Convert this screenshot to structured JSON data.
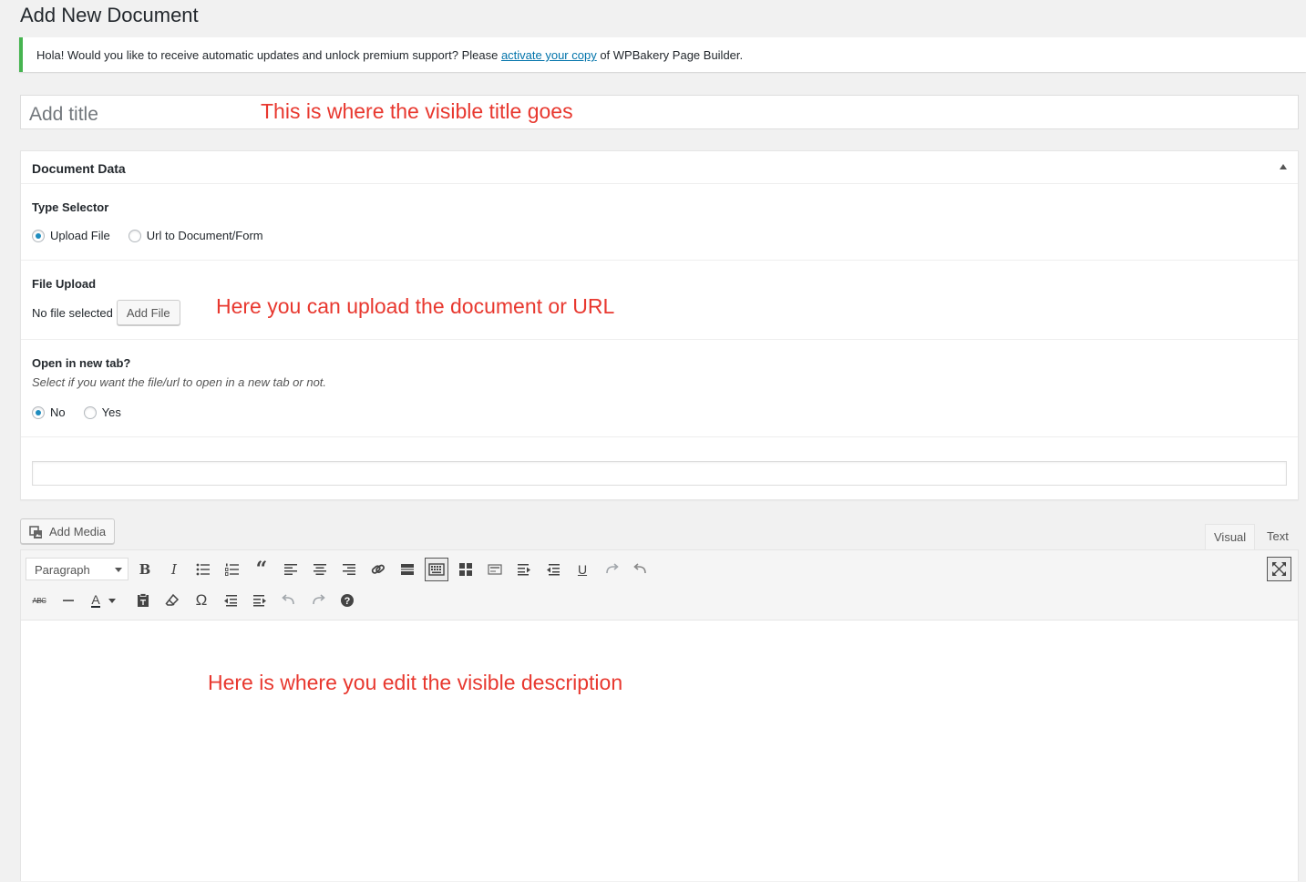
{
  "page": {
    "title": "Add New Document"
  },
  "notice": {
    "text_before": "Hola! Would you like to receive automatic updates and unlock premium support? Please ",
    "link_text": "activate your copy",
    "text_after": " of WPBakery Page Builder."
  },
  "title_field": {
    "placeholder": "Add title",
    "value": ""
  },
  "annotations": {
    "title": "This is where the visible title goes",
    "upload": "Here you can upload the document or URL",
    "description": "Here is where you edit the visible description"
  },
  "document_data": {
    "heading": "Document Data",
    "type_selector": {
      "label": "Type Selector",
      "options": [
        "Upload File",
        "Url to Document/Form"
      ],
      "selected": "Upload File"
    },
    "file_upload": {
      "label": "File Upload",
      "status": "No file selected",
      "button": "Add File"
    },
    "new_tab": {
      "label": "Open in new tab?",
      "description": "Select if you want the file/url to open in a new tab or not.",
      "options": [
        "No",
        "Yes"
      ],
      "selected": "No"
    }
  },
  "editor": {
    "add_media": "Add Media",
    "tabs": [
      "Visual",
      "Text"
    ],
    "active_tab": "Visual",
    "format_select": "Paragraph",
    "toolbar_row1": [
      "bold-icon",
      "italic-icon",
      "bullet-list-icon",
      "numbered-list-icon",
      "blockquote-icon",
      "align-left-icon",
      "align-center-icon",
      "align-right-icon",
      "link-icon",
      "read-more-icon",
      "toolbar-toggle-icon",
      "shortcode-grid-icon",
      "template-icon",
      "indent-icon",
      "outdent-icon",
      "underline-icon",
      "redo-icon",
      "undo-icon"
    ],
    "toolbar_row2": [
      "strikethrough-icon",
      "horizontal-line-icon",
      "text-color-icon",
      "paste-text-icon",
      "clear-format-icon",
      "special-character-icon",
      "outdent-icon",
      "indent-icon",
      "undo-icon",
      "redo-icon",
      "help-icon"
    ],
    "fullscreen_icon": "fullscreen-icon",
    "colors": {
      "accent": "#0073aa",
      "notice_border": "#46b450",
      "annotation": "#e8382f"
    }
  }
}
